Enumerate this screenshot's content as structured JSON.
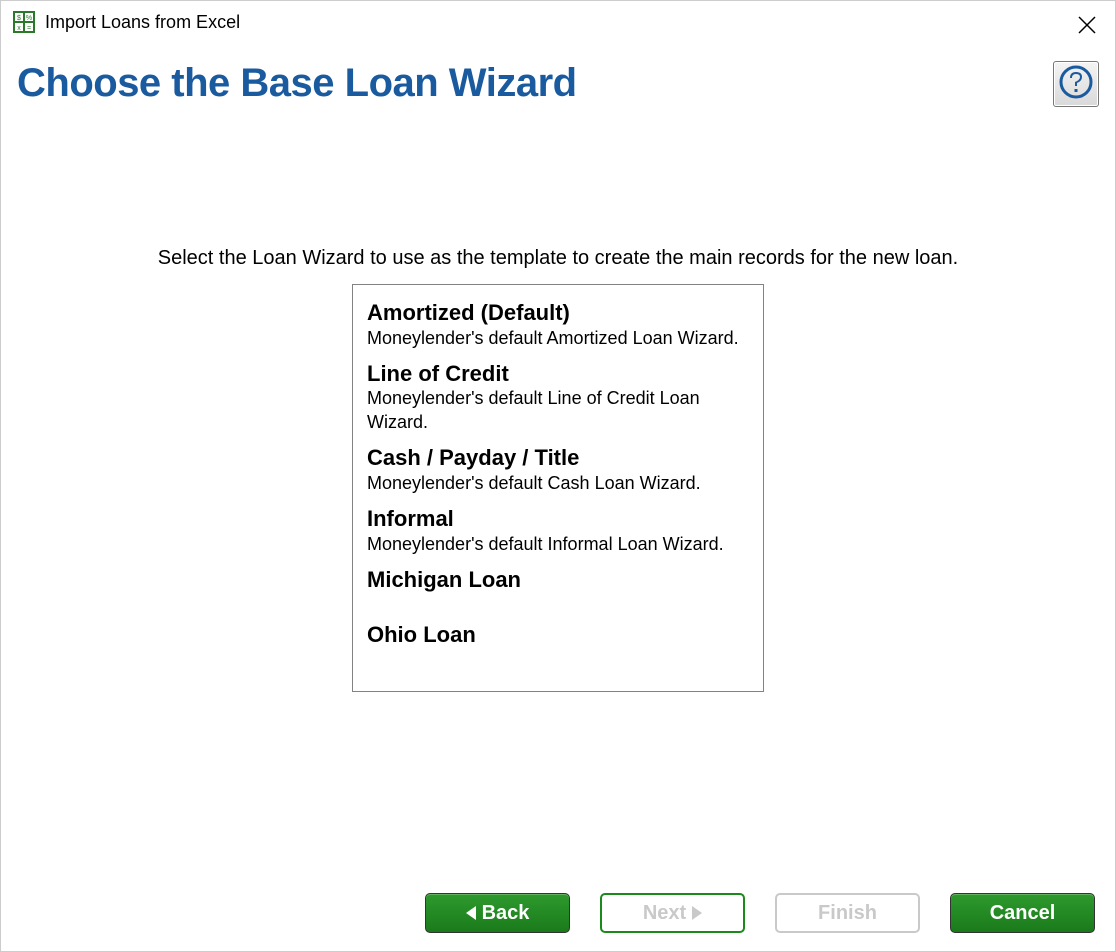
{
  "window": {
    "title": "Import Loans from Excel"
  },
  "header": {
    "heading": "Choose the Base Loan Wizard"
  },
  "instruction": "Select the Loan Wizard to use as the template to create the main records for the new loan.",
  "wizards": [
    {
      "title": "Amortized (Default)",
      "desc": "Moneylender's default Amortized Loan Wizard."
    },
    {
      "title": "Line of Credit",
      "desc": "Moneylender's default Line of Credit Loan Wizard."
    },
    {
      "title": "Cash / Payday / Title",
      "desc": "Moneylender's default Cash Loan Wizard."
    },
    {
      "title": "Informal",
      "desc": "Moneylender's default Informal Loan Wizard."
    },
    {
      "title": "Michigan Loan",
      "desc": ""
    },
    {
      "title": "Ohio Loan",
      "desc": ""
    }
  ],
  "buttons": {
    "back": "Back",
    "next": "Next",
    "finish": "Finish",
    "cancel": "Cancel"
  }
}
